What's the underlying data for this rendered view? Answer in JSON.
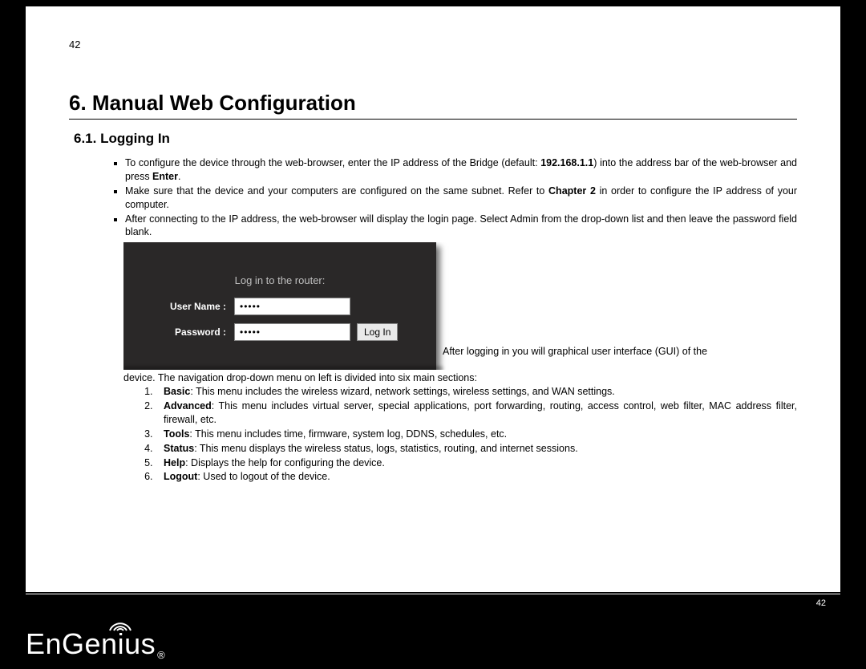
{
  "page_number_top": "42",
  "page_number_bottom": "42",
  "heading": "6. Manual Web Configuration",
  "subheading": "6.1.   Logging In",
  "bullets": {
    "b1_pre": "To configure the device through the web-browser, enter the IP address of the Bridge (default: ",
    "b1_bold": "192.168.1.1",
    "b1_post": ") into the address bar of the web-browser and press ",
    "b1_bold2": "Enter",
    "b1_end": ".",
    "b2_pre": "Make sure that the device and your computers are configured on the same subnet. Refer to ",
    "b2_bold": "Chapter 2",
    "b2_post": " in order to configure the IP address of your computer.",
    "b3": "After connecting to the IP address, the web-browser will display the login page. Select Admin from the drop-down list and then leave the password field blank."
  },
  "login": {
    "header": "Log in to the router:",
    "username_label": "User Name :",
    "password_label": "Password :",
    "username_value": "•••••",
    "password_value": "•••••",
    "button": "Log In"
  },
  "after_login_line1": "After logging in you will graphical user interface (GUI) of the",
  "after_login_line2": "device. The navigation drop-down menu on left is divided into six main sections:",
  "sections": {
    "s1_bold": "Basic",
    "s1_text": ": This menu includes the wireless wizard, network settings, wireless settings, and WAN settings.",
    "s2_bold": "Advanced",
    "s2_text": ": This menu includes virtual server, special applications, port forwarding, routing, access control, web filter, MAC address filter, firewall, etc.",
    "s3_bold": "Tools",
    "s3_text": ": This menu includes time, firmware, system log, DDNS, schedules, etc.",
    "s4_bold": "Status",
    "s4_text": ": This menu displays the wireless status, logs, statistics, routing, and internet sessions.",
    "s5_bold": "Help",
    "s5_text": ": Displays the help for configuring the device.",
    "s6_bold": "Logout",
    "s6_text": ":  Used to logout of the device."
  },
  "brand": "EnGenius"
}
